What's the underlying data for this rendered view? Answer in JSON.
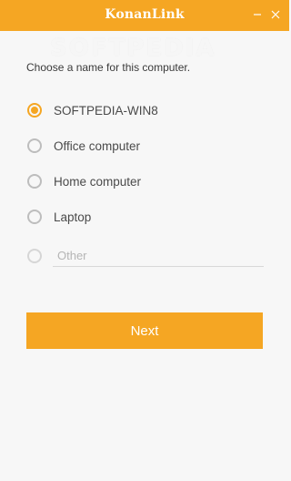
{
  "app": {
    "title": "KonanLink",
    "watermark": "SOFTPEDIA"
  },
  "window_controls": {
    "minimize_icon": "minimize-icon",
    "close_icon": "close-icon"
  },
  "prompt": "Choose a name for this computer.",
  "options": [
    {
      "label": "SOFTPEDIA-WIN8",
      "selected": true
    },
    {
      "label": "Office computer",
      "selected": false
    },
    {
      "label": "Home computer",
      "selected": false
    },
    {
      "label": "Laptop",
      "selected": false
    }
  ],
  "other": {
    "placeholder": "Other",
    "value": "",
    "selected": false
  },
  "next_label": "Next",
  "colors": {
    "accent": "#f5a623",
    "background": "#f7f7f7"
  }
}
